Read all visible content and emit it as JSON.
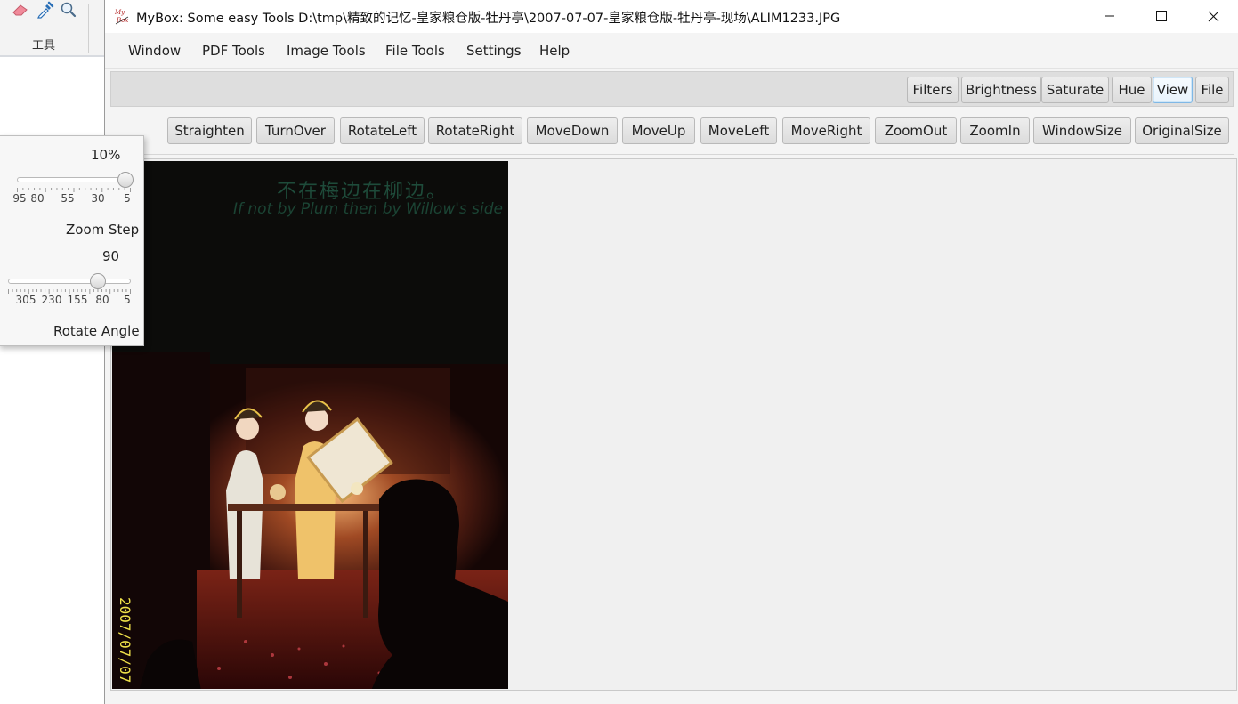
{
  "background_app": {
    "ribbon_label": "工具",
    "tools": [
      {
        "icon": "eraser-icon"
      },
      {
        "icon": "eyedropper-icon"
      },
      {
        "icon": "magnifier-icon"
      }
    ]
  },
  "window": {
    "title": "MyBox: Some easy Tools  D:\\tmp\\精致的记忆-皇家粮仓版-牡丹亭\\2007-07-07-皇家粮仓版-牡丹亭-现场\\ALIM1233.JPG",
    "app_icon_text": "My Box",
    "controls": {
      "minimize": "minimize-icon",
      "maximize": "maximize-icon",
      "close": "close-icon"
    }
  },
  "menubar": {
    "items": [
      "Window",
      "PDF Tools",
      "Image Tools",
      "File Tools",
      "Settings",
      "Help"
    ]
  },
  "toolbar1": {
    "buttons": [
      "Filters",
      "Brightness",
      "Saturate",
      "Hue",
      "View",
      "File"
    ],
    "active": "View"
  },
  "toolbar2": {
    "collapse_glyph": "<<",
    "buttons": [
      "Straighten",
      "TurnOver",
      "RotateLeft",
      "RotateRight",
      "MoveDown",
      "MoveUp",
      "MoveLeft",
      "MoveRight",
      "ZoomOut",
      "ZoomIn",
      "WindowSize",
      "OriginalSize"
    ]
  },
  "image": {
    "caption_cn": "不在梅边在柳边。",
    "caption_en": "If not by Plum then by Willow's side",
    "date_stamp": "2007/07/07"
  },
  "popup": {
    "zoom_step": {
      "value_text": "10%",
      "label": "Zoom Step",
      "ticks": [
        "95",
        "80",
        "55",
        "30",
        "5"
      ],
      "level": 0.95
    },
    "rotate_angle": {
      "value_text": "90",
      "label": "Rotate Angle",
      "ticks": [
        "305",
        "230",
        "155",
        "80",
        "5"
      ],
      "level": 0.73
    }
  },
  "colors": {
    "active_border": "#7fb8e6",
    "window_bg": "#f4f4f4",
    "stamp": "#f0e24a"
  }
}
